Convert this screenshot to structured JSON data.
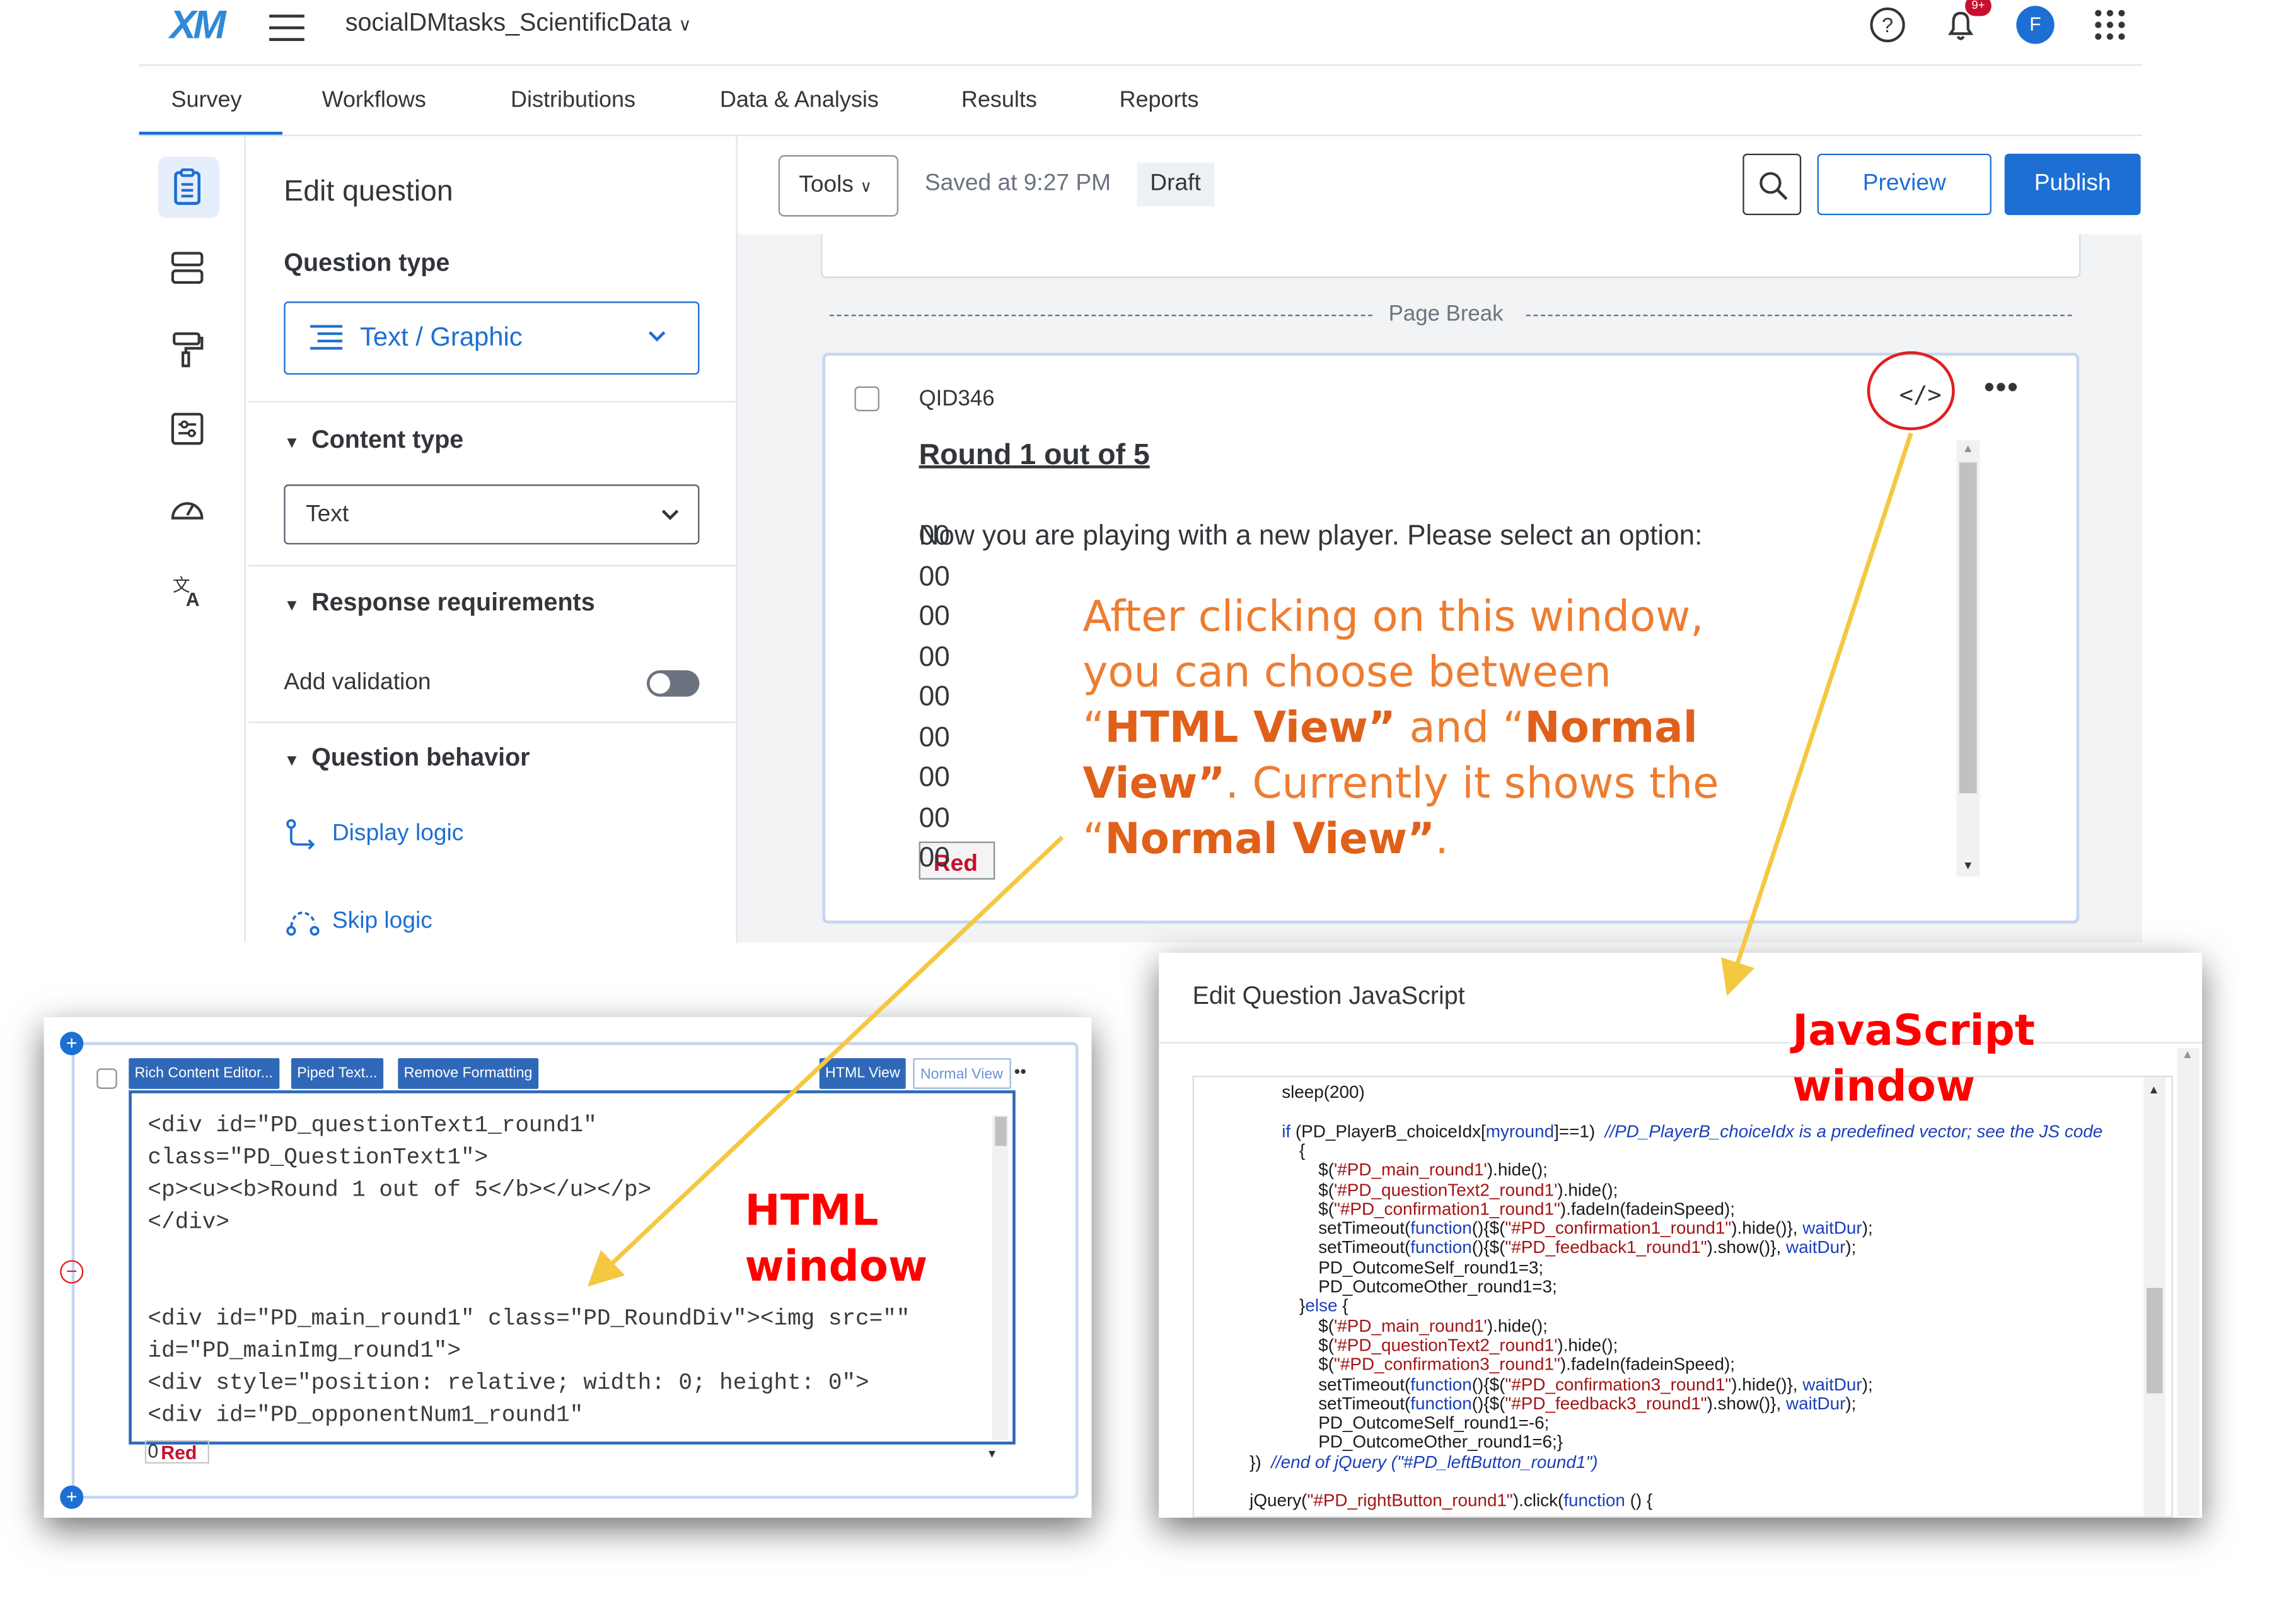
{
  "header": {
    "logo": "XM",
    "project_name": "socialDMtasks_ScientificData",
    "notification_badge": "9+",
    "avatar_initial": "F"
  },
  "nav": {
    "tabs": [
      "Survey",
      "Workflows",
      "Distributions",
      "Data & Analysis",
      "Results",
      "Reports"
    ],
    "active_tab": "Survey"
  },
  "edit_panel": {
    "title": "Edit question",
    "question_type_label": "Question type",
    "question_type_value": "Text / Graphic",
    "content_type_label": "Content type",
    "content_type_value": "Text",
    "response_req_label": "Response requirements",
    "add_validation_label": "Add validation",
    "question_behavior_label": "Question behavior",
    "display_logic": "Display logic",
    "skip_logic": "Skip logic"
  },
  "toolbar": {
    "tools": "Tools",
    "saved": "Saved at 9:27 PM",
    "draft": "Draft",
    "preview": "Preview",
    "publish": "Publish"
  },
  "question": {
    "page_break": "Page Break",
    "qid": "QID346",
    "round": "Round 1 out of 5",
    "text": "Now you are playing with a new player. Please select an option:",
    "text_overlay": "00",
    "zeros": [
      "00",
      "00",
      "00",
      "00",
      "00",
      "00",
      "00"
    ],
    "button_zero": "00",
    "button_label": "Red"
  },
  "annotation": {
    "line1": "After clicking on this window,",
    "line2": "you can choose between",
    "q_open": "“",
    "html_view": "HTML View”",
    "and": " and “",
    "normal_view_a": "Normal",
    "normal_view_b": "View”",
    "rest": ". Currently it shows the",
    "q_open2": "“",
    "normal_view_c": "Normal View”",
    "period": "."
  },
  "html_window": {
    "label_line1": "HTML",
    "label_line2": "window",
    "toolbar": [
      "Rich Content Editor...",
      "Piped Text...",
      "Remove Formatting"
    ],
    "html_view_btn": "HTML View",
    "normal_view_btn": "Normal View",
    "code_lines": [
      "<div id=\"PD_questionText1_round1\"",
      "class=\"PD_QuestionText1\">",
      "<p><u><b>Round 1 out of 5</b></u></p>",
      "</div>",
      "",
      "",
      "<div id=\"PD_main_round1\" class=\"PD_RoundDiv\"><img src=\"\"",
      "id=\"PD_mainImg_round1\">",
      "<div style=\"position: relative; width: 0; height: 0\">",
      "<div id=\"PD_opponentNum1_round1\""
    ],
    "bottom_label": "Red",
    "bottom_zero": "0"
  },
  "js_window": {
    "title": "Edit Question JavaScript",
    "label_line1": "JavaScript",
    "label_line2": "window",
    "code_lines": [
      {
        "indent": 60,
        "t": "sleep(200)"
      },
      {
        "indent": 0,
        "t": ""
      },
      {
        "indent": 60,
        "t": "if (PD_PlayerB_choiceIdx[myround]==1)  //PD_PlayerB_choiceIdx is a predefined vector; see the JS code"
      },
      {
        "indent": 72,
        "t": "{"
      },
      {
        "indent": 85,
        "t": "$('#PD_main_round1').hide();"
      },
      {
        "indent": 85,
        "t": "$('#PD_questionText2_round1').hide();"
      },
      {
        "indent": 85,
        "t": "$(\"#PD_confirmation1_round1\").fadeIn(fadeinSpeed);"
      },
      {
        "indent": 85,
        "t": "setTimeout(function(){$(\"#PD_confirmation1_round1\").hide()}, waitDur);"
      },
      {
        "indent": 85,
        "t": "setTimeout(function(){$(\"#PD_feedback1_round1\").show()}, waitDur);"
      },
      {
        "indent": 85,
        "t": "PD_OutcomeSelf_round1=3;"
      },
      {
        "indent": 85,
        "t": "PD_OutcomeOther_round1=3;"
      },
      {
        "indent": 72,
        "t": "}else {"
      },
      {
        "indent": 85,
        "t": "$('#PD_main_round1').hide();"
      },
      {
        "indent": 85,
        "t": "$('#PD_questionText2_round1').hide();"
      },
      {
        "indent": 85,
        "t": "$(\"#PD_confirmation3_round1\").fadeIn(fadeinSpeed);"
      },
      {
        "indent": 85,
        "t": "setTimeout(function(){$(\"#PD_confirmation3_round1\").hide()}, waitDur);"
      },
      {
        "indent": 85,
        "t": "setTimeout(function(){$(\"#PD_feedback3_round1\").show()}, waitDur);"
      },
      {
        "indent": 85,
        "t": "PD_OutcomeSelf_round1=-6;"
      },
      {
        "indent": 85,
        "t": "PD_OutcomeOther_round1=6;}"
      },
      {
        "indent": 38,
        "t": "})  //end of jQuery (\"#PD_leftButton_round1\")"
      },
      {
        "indent": 0,
        "t": ""
      },
      {
        "indent": 38,
        "t": "jQuery(\"#PD_rightButton_round1\").click(function () {"
      }
    ]
  },
  "colors": {
    "accent": "#1d6fd3",
    "annotation": "#ed7d31",
    "label_red": "#ff0000",
    "arrow": "#f5c842"
  }
}
